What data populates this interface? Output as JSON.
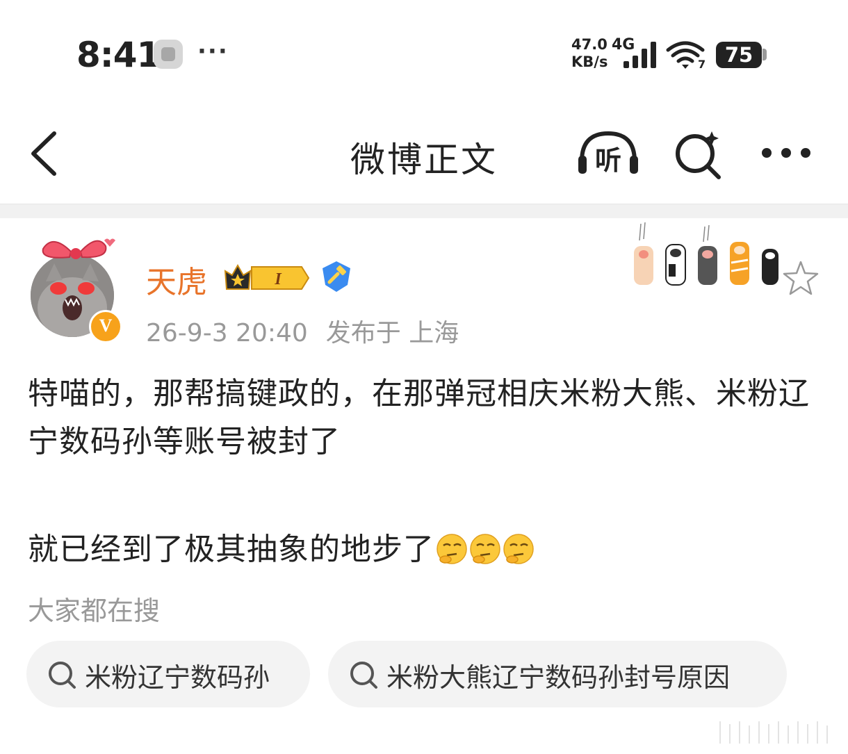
{
  "status_bar": {
    "time": "8:41",
    "more": "···",
    "speed_value": "47.0",
    "speed_unit": "KB/s",
    "network": "4G",
    "battery": "75",
    "wifi_level": "7"
  },
  "nav": {
    "title": "微博正文",
    "listen_label": "听"
  },
  "post": {
    "username": "天虎",
    "vip_level": "I",
    "verified_badge": "V",
    "time": "26-9-3 20:40",
    "location": "发布于 上海",
    "paragraph_1": "特喵的，那帮搞键政的，在那弹冠相庆米粉大熊、米粉辽宁数码孙等账号被封了",
    "paragraph_2": "就已经到了极其抽象的地步了"
  },
  "hot_search": {
    "title": "大家都在搜",
    "items": [
      {
        "label": "米粉辽宁数码孙"
      },
      {
        "label": "米粉大熊辽宁数码孙封号原因"
      }
    ]
  },
  "colors": {
    "username": "#e8742b",
    "meta": "#999999",
    "chip_bg": "#f3f3f3",
    "vip_badge": "#f7a21b"
  }
}
